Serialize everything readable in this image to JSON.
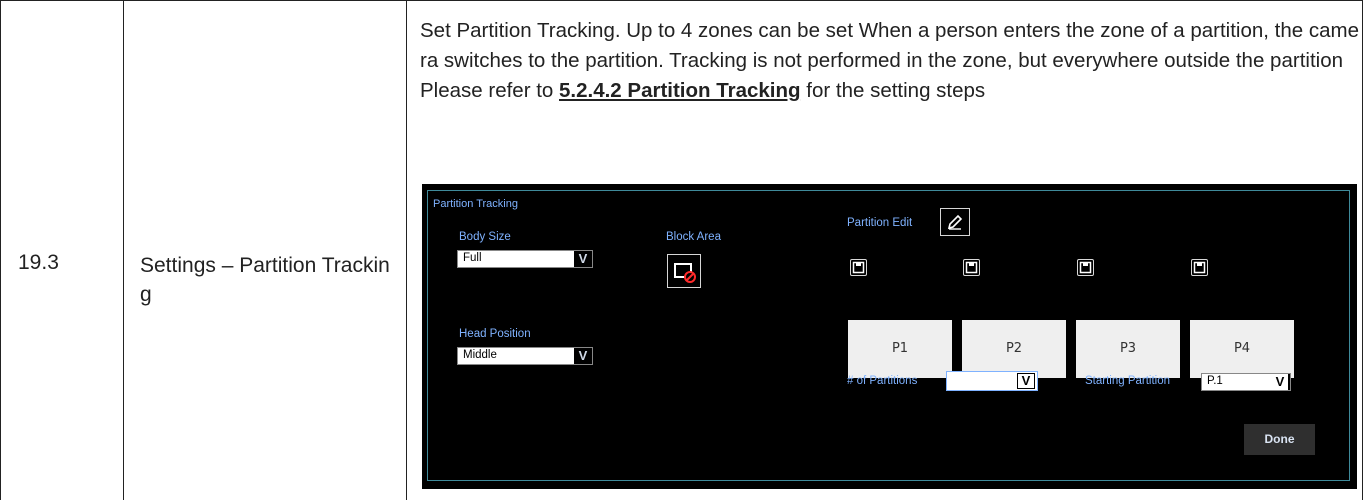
{
  "row": {
    "number": "19.3",
    "name": "Settings – Partition Tracking",
    "description_text": "Set Partition Tracking. Up to 4 zones can be set When a person enters the zone of a partition, the camera switches to the partition. Tracking is not performed in the zone, but everywhere outside the partition Please refer to ",
    "description_link": "5.2.4.2 Partition Tracking",
    "description_tail": " for the setting steps"
  },
  "app": {
    "title": "Partition Tracking",
    "body_size": {
      "label": "Body Size",
      "value": "Full"
    },
    "head_position": {
      "label": "Head Position",
      "value": "Middle"
    },
    "block_area": {
      "label": "Block Area",
      "icon": "block-area-icon"
    },
    "partition_edit": {
      "label": "Partition Edit",
      "icon": "pencil-icon"
    },
    "partitions": [
      {
        "label": "P1"
      },
      {
        "label": "P2"
      },
      {
        "label": "P3"
      },
      {
        "label": "P4"
      }
    ],
    "num_partitions": {
      "label": "# of Partitions",
      "value": ""
    },
    "starting_partition": {
      "label": "Starting Partition",
      "value": "P.1"
    },
    "done_label": "Done",
    "arrow_glyph": "V",
    "accent_color": "#7fb2ff",
    "frame_color": "#3f8a9a"
  }
}
